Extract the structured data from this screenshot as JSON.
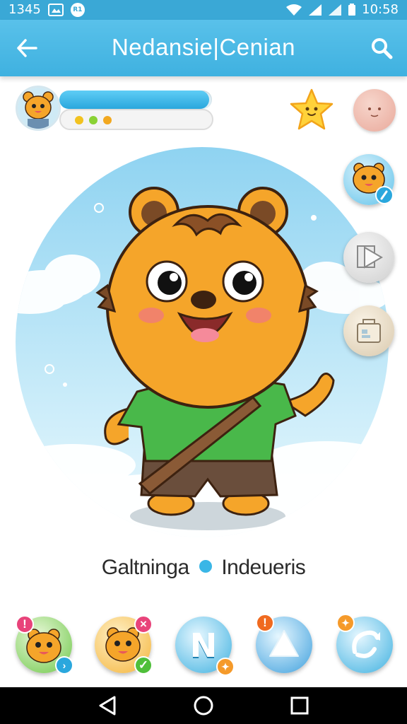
{
  "status_bar": {
    "left_time": "1345",
    "carrier_badge": "R1",
    "clock": "10:58",
    "icons": [
      "screenshot-icon",
      "carrier-icon",
      "wifi-icon",
      "signal-icon",
      "signal-icon",
      "battery-icon"
    ]
  },
  "app_bar": {
    "title": "Nedansie|Cenian",
    "back_icon": "arrow-left-icon",
    "search_icon": "search-icon"
  },
  "profile": {
    "progress": 0.98,
    "dots": [
      "#f2c21f",
      "#8ad234",
      "#f2a81f"
    ]
  },
  "character": {
    "name": "Galtninga",
    "status": "Indeueris",
    "status_dot_color": "#3ab6e6"
  },
  "side_actions": [
    {
      "name": "character-edit",
      "icon": "edit-icon"
    },
    {
      "name": "play",
      "icon": "play-icon"
    },
    {
      "name": "wardrobe",
      "icon": "bag-icon"
    }
  ],
  "bottom_actions": [
    {
      "name": "friend-alert",
      "badge": "!",
      "badge_color": "#e8437a"
    },
    {
      "name": "friend-accepted",
      "badge": "×",
      "badge_color": "#e8437a"
    },
    {
      "name": "n-app",
      "letter": "N"
    },
    {
      "name": "triangle-app",
      "badge": "!",
      "badge_color": "#f06a1f"
    },
    {
      "name": "sync-app"
    }
  ],
  "nav": [
    "back-icon",
    "home-icon",
    "recents-icon"
  ],
  "colors": {
    "accent": "#3fb1e0",
    "character": "#f5a52a",
    "shirt": "#49b84a"
  }
}
